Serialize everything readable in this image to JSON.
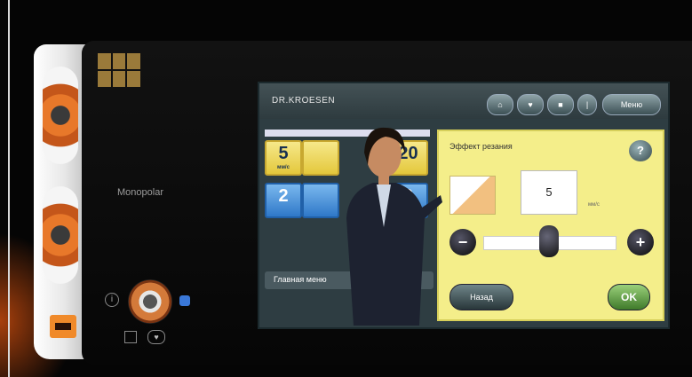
{
  "device": {
    "monitor_label": "Monopolar",
    "info_glyph": "i"
  },
  "screen": {
    "title": "DR.KROESEN",
    "toolbar": [
      {
        "icon": "home-icon",
        "label": ""
      },
      {
        "icon": "heart-icon",
        "label": ""
      },
      {
        "icon": "lock-icon",
        "label": ""
      },
      {
        "icon": "pin-icon",
        "label": ""
      },
      {
        "label": "Меню"
      }
    ],
    "tiles": [
      {
        "value": "5",
        "sub": "мм/с",
        "color": "yellow"
      },
      {
        "value": "",
        "sub": "",
        "color": "yellow"
      },
      {
        "value": "120",
        "sub": "",
        "color": "yellow"
      },
      {
        "value": "2",
        "sub": "",
        "color": "blue"
      },
      {
        "value": "",
        "sub": "",
        "color": "blue"
      },
      {
        "value": "50",
        "sub": "",
        "color": "blue"
      }
    ],
    "nav_strip": "Главная меню",
    "panel": {
      "title": "Эффект резания",
      "help": "?",
      "value": "5",
      "unit": "мм/с",
      "minus": "−",
      "plus": "+",
      "slider_level": 0.5,
      "back_label": "Назад",
      "ok_label": "OK"
    }
  },
  "colors": {
    "panel_bg": "#f4ee8a",
    "screen_bg": "#2e3d42",
    "accent_orange": "#e8782a"
  }
}
